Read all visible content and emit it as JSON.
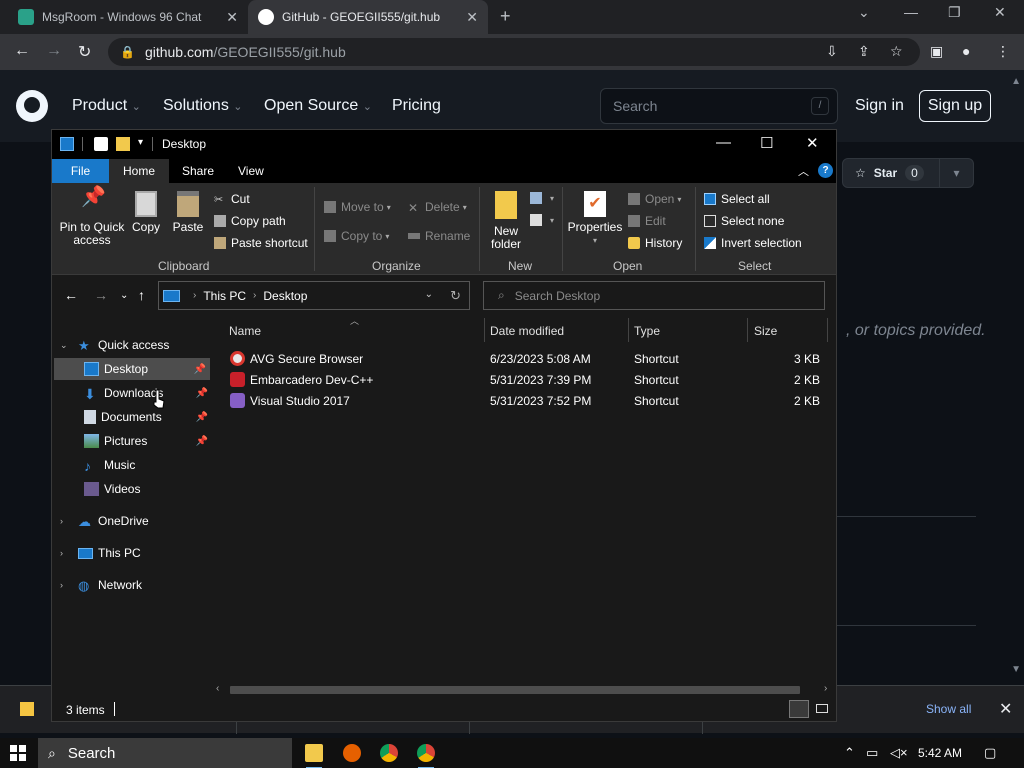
{
  "browser": {
    "tabs": [
      {
        "title": "MsgRoom - Windows 96 Chat",
        "active": false
      },
      {
        "title": "GitHub - GEOEGII555/git.hub",
        "active": true
      }
    ],
    "url_host": "github.com",
    "url_path": "/GEOEGII555/git.hub"
  },
  "github": {
    "nav": [
      "Product",
      "Solutions",
      "Open Source",
      "Pricing"
    ],
    "search_placeholder": "Search",
    "search_shortcut": "/",
    "sign_in": "Sign in",
    "sign_up": "Sign up",
    "star_label": "Star",
    "star_count": "0",
    "about_text": ", or topics provided."
  },
  "explorer": {
    "window_title": "Desktop",
    "ribbon_tabs": [
      "File",
      "Home",
      "Share",
      "View"
    ],
    "clipboard": {
      "group": "Clipboard",
      "pin": "Pin to Quick access",
      "copy": "Copy",
      "paste": "Paste",
      "cut": "Cut",
      "copy_path": "Copy path",
      "paste_shortcut": "Paste shortcut"
    },
    "organize": {
      "group": "Organize",
      "move_to": "Move to",
      "copy_to": "Copy to",
      "delete": "Delete",
      "rename": "Rename"
    },
    "new": {
      "group": "New",
      "new_folder": "New folder"
    },
    "open": {
      "group": "Open",
      "properties": "Properties",
      "open": "Open",
      "edit": "Edit",
      "history": "History"
    },
    "select": {
      "group": "Select",
      "select_all": "Select all",
      "select_none": "Select none",
      "invert": "Invert selection"
    },
    "address": {
      "segments": [
        "This PC",
        "Desktop"
      ]
    },
    "search_placeholder": "Search Desktop",
    "nav": {
      "quick_access": "Quick access",
      "desktop": "Desktop",
      "downloads": "Downloads",
      "documents": "Documents",
      "pictures": "Pictures",
      "music": "Music",
      "videos": "Videos",
      "onedrive": "OneDrive",
      "this_pc": "This PC",
      "network": "Network"
    },
    "columns": [
      "Name",
      "Date modified",
      "Type",
      "Size"
    ],
    "files": [
      {
        "name": "AVG Secure Browser",
        "date": "6/23/2023 5:08 AM",
        "type": "Shortcut",
        "size": "3 KB",
        "color": "#e8e8e8"
      },
      {
        "name": "Embarcadero Dev-C++",
        "date": "5/31/2023 7:39 PM",
        "type": "Shortcut",
        "size": "2 KB",
        "color": "#c8202a"
      },
      {
        "name": "Visual Studio 2017",
        "date": "5/31/2023 7:52 PM",
        "type": "Shortcut",
        "size": "2 KB",
        "color": "#865fc5"
      }
    ],
    "status": "3 items"
  },
  "download_bar": {
    "show_all": "Show all"
  },
  "taskbar": {
    "search": "Search",
    "time": "5:42 AM"
  },
  "colors": {
    "accent": "#1979ca",
    "github_bg": "#0d1117",
    "explorer_bg": "#191919"
  }
}
